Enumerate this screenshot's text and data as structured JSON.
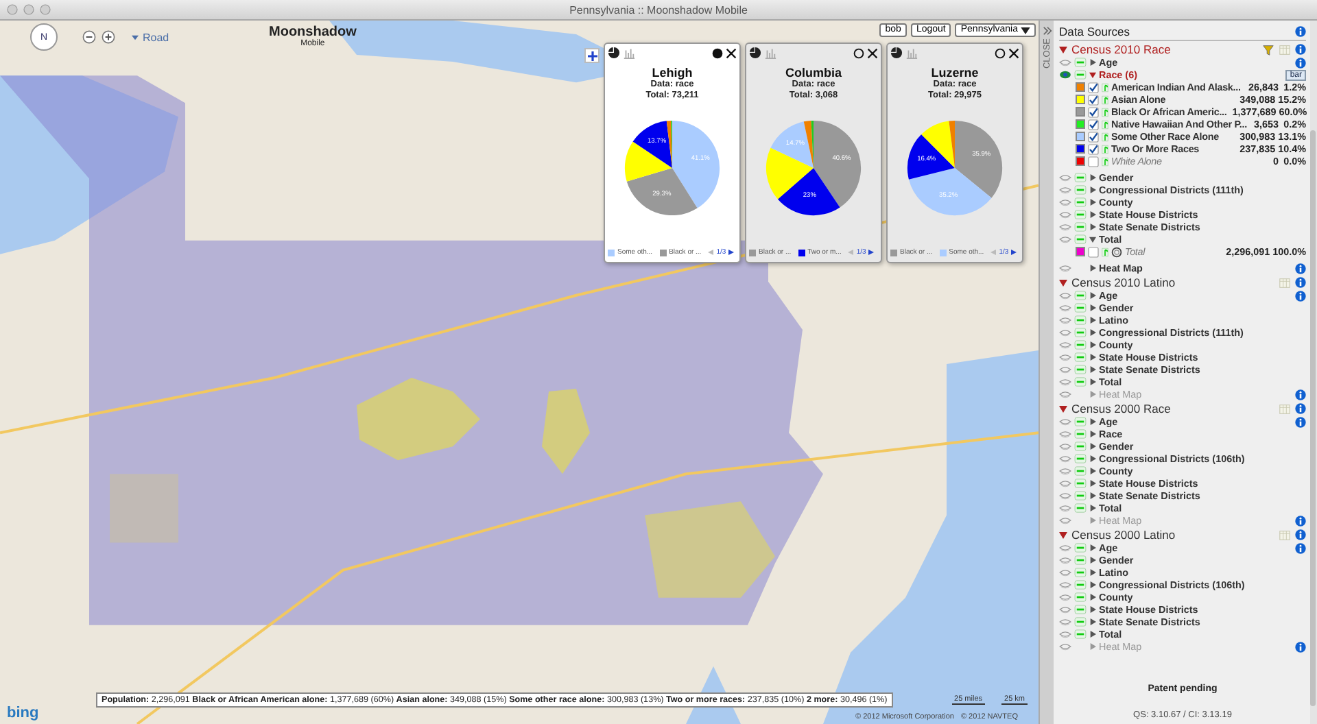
{
  "window": {
    "title": "Pennsylvania :: Moonshadow Mobile"
  },
  "map_controls": {
    "compass_label": "N",
    "map_type": "Road"
  },
  "logo": {
    "name": "Moonshadow",
    "sub": "Mobile"
  },
  "user_bar": {
    "user": "bob",
    "logout": "Logout",
    "region": "Pennsylvania"
  },
  "popups": [
    {
      "title": "Lehigh",
      "data": "Data: race",
      "total": "Total: 73,211",
      "selected": true,
      "chart_data": {
        "type": "pie",
        "colors": [
          "#aaccff",
          "#999999",
          "#ffff00",
          "#0000ee",
          "#f08000",
          "#22cc22"
        ],
        "values": [
          41.1,
          29.3,
          14.0,
          13.7,
          1.5,
          0.4
        ],
        "value_labels": [
          "41.1%",
          "29.3%",
          null,
          "13.7%",
          null,
          null
        ]
      },
      "legend": [
        {
          "label": "Some oth...",
          "color": "#aaccff"
        },
        {
          "label": "Black or ...",
          "color": "#999999"
        }
      ],
      "page": "1/3"
    },
    {
      "title": "Columbia",
      "data": "Data: race",
      "total": "Total: 3,068",
      "selected": false,
      "chart_data": {
        "type": "pie",
        "colors": [
          "#999999",
          "#0000ee",
          "#ffff00",
          "#aaccff",
          "#f08000",
          "#22cc22"
        ],
        "values": [
          40.6,
          23.0,
          18.4,
          14.7,
          2.5,
          0.8
        ],
        "value_labels": [
          "40.6%",
          "23%",
          null,
          "14.7%",
          null,
          null
        ]
      },
      "legend": [
        {
          "label": "Black or ...",
          "color": "#999999"
        },
        {
          "label": "Two or m...",
          "color": "#0000ee"
        }
      ],
      "page": "1/3"
    },
    {
      "title": "Luzerne",
      "data": "Data: race",
      "total": "Total: 29,975",
      "selected": false,
      "chart_data": {
        "type": "pie",
        "colors": [
          "#999999",
          "#aaccff",
          "#0000ee",
          "#ffff00",
          "#f08000"
        ],
        "values": [
          35.9,
          35.2,
          16.4,
          10.5,
          2.0
        ],
        "value_labels": [
          "35.9%",
          "35.2%",
          "16.4%",
          null,
          null
        ]
      },
      "legend": [
        {
          "label": "Black or ...",
          "color": "#999999"
        },
        {
          "label": "Some oth...",
          "color": "#aaccff"
        }
      ],
      "page": "1/3"
    }
  ],
  "close_tab": {
    "label": "CLOSE"
  },
  "status_bar": {
    "summary": "**Population:** 2,296,091  **Black or African American alone:** 1,377,689 (60%)  **Asian alone:** 349,088 (15%)  **Some other race alone:** 300,983 (13%)  **Two or more races:** 237,835 (10%)  **2 more:** 30,496 (1%)",
    "brand": "bing",
    "scale_miles": "25 miles",
    "scale_km": "25 km",
    "copyright": [
      "© 2012 Microsoft Corporation",
      "© 2012 NAVTEQ"
    ]
  },
  "sidebar": {
    "title": "Data Sources",
    "sections": [
      {
        "title": "Census 2010 Race",
        "selected": true,
        "filter": true,
        "items": [
          {
            "label": "Age",
            "kind": "layer",
            "visible": false,
            "expanded": false,
            "info": true,
            "disabled": false
          },
          {
            "label": "Race (6)",
            "kind": "layer",
            "visible": true,
            "expanded": true,
            "info": false,
            "disabled": false,
            "badge": "bar",
            "children": [
              {
                "label": "American Indian And Alask...",
                "value": "26,843",
                "pct": "1.2%",
                "color": "#f08000",
                "checked": true,
                "kind": "value"
              },
              {
                "label": "Asian Alone",
                "value": "349,088",
                "pct": "15.2%",
                "color": "#ffff00",
                "checked": true,
                "kind": "value"
              },
              {
                "label": "Black Or African Americ...",
                "value": "1,377,689",
                "pct": "60.0%",
                "color": "#999999",
                "checked": true,
                "kind": "value"
              },
              {
                "label": "Native Hawaiian And Other P...",
                "value": "3,653",
                "pct": "0.2%",
                "color": "#22ee22",
                "checked": true,
                "kind": "value"
              },
              {
                "label": "Some Other Race Alone",
                "value": "300,983",
                "pct": "13.1%",
                "color": "#aaccff",
                "checked": true,
                "kind": "value"
              },
              {
                "label": "Two Or More Races",
                "value": "237,835",
                "pct": "10.4%",
                "color": "#0000ee",
                "checked": true,
                "kind": "value"
              },
              {
                "label": "White Alone",
                "value": "0",
                "pct": "0.0%",
                "color": "#ee0000",
                "checked": false,
                "kind": "value"
              }
            ]
          },
          {
            "label": "Gender",
            "kind": "layer",
            "visible": false,
            "expanded": false,
            "info": false,
            "disabled": false
          },
          {
            "label": "Congressional Districts (111th)",
            "kind": "layer",
            "visible": false,
            "expanded": false,
            "info": false,
            "disabled": false
          },
          {
            "label": "County",
            "kind": "layer",
            "visible": false,
            "expanded": false,
            "info": false,
            "disabled": false
          },
          {
            "label": "State House Districts",
            "kind": "layer",
            "visible": false,
            "expanded": false,
            "info": false,
            "disabled": false
          },
          {
            "label": "State Senate Districts",
            "kind": "layer",
            "visible": false,
            "expanded": false,
            "info": false,
            "disabled": false
          },
          {
            "label": "Total",
            "kind": "layer",
            "visible": false,
            "expanded": true,
            "info": false,
            "disabled": false,
            "children": [
              {
                "label": "Total",
                "value": "2,296,091",
                "pct": "100.0%",
                "color": "#ee00cc",
                "checked": false,
                "kind": "total"
              }
            ]
          },
          {
            "label": "Heat Map",
            "kind": "heatmap",
            "visible": false,
            "expanded": false,
            "info": true,
            "disabled": false
          }
        ]
      },
      {
        "title": "Census 2010 Latino",
        "selected": false,
        "filter": false,
        "items": [
          {
            "label": "Age",
            "kind": "layer",
            "visible": false,
            "expanded": false,
            "info": true,
            "disabled": false
          },
          {
            "label": "Gender",
            "kind": "layer",
            "visible": false,
            "expanded": false,
            "info": false,
            "disabled": false
          },
          {
            "label": "Latino",
            "kind": "layer",
            "visible": false,
            "expanded": false,
            "info": false,
            "disabled": false
          },
          {
            "label": "Congressional Districts (111th)",
            "kind": "layer",
            "visible": false,
            "expanded": false,
            "info": false,
            "disabled": false
          },
          {
            "label": "County",
            "kind": "layer",
            "visible": false,
            "expanded": false,
            "info": false,
            "disabled": false
          },
          {
            "label": "State House Districts",
            "kind": "layer",
            "visible": false,
            "expanded": false,
            "info": false,
            "disabled": false
          },
          {
            "label": "State Senate Districts",
            "kind": "layer",
            "visible": false,
            "expanded": false,
            "info": false,
            "disabled": false
          },
          {
            "label": "Total",
            "kind": "layer",
            "visible": false,
            "expanded": false,
            "info": false,
            "disabled": false
          },
          {
            "label": "Heat Map",
            "kind": "heatmap",
            "visible": false,
            "expanded": false,
            "info": true,
            "disabled": true
          }
        ]
      },
      {
        "title": "Census 2000 Race",
        "selected": false,
        "filter": false,
        "items": [
          {
            "label": "Age",
            "kind": "layer",
            "visible": false,
            "expanded": false,
            "info": true,
            "disabled": false
          },
          {
            "label": "Race",
            "kind": "layer",
            "visible": false,
            "expanded": false,
            "info": false,
            "disabled": false
          },
          {
            "label": "Gender",
            "kind": "layer",
            "visible": false,
            "expanded": false,
            "info": false,
            "disabled": false
          },
          {
            "label": "Congressional Districts (106th)",
            "kind": "layer",
            "visible": false,
            "expanded": false,
            "info": false,
            "disabled": false
          },
          {
            "label": "County",
            "kind": "layer",
            "visible": false,
            "expanded": false,
            "info": false,
            "disabled": false
          },
          {
            "label": "State House Districts",
            "kind": "layer",
            "visible": false,
            "expanded": false,
            "info": false,
            "disabled": false
          },
          {
            "label": "State Senate Districts",
            "kind": "layer",
            "visible": false,
            "expanded": false,
            "info": false,
            "disabled": false
          },
          {
            "label": "Total",
            "kind": "layer",
            "visible": false,
            "expanded": false,
            "info": false,
            "disabled": false
          },
          {
            "label": "Heat Map",
            "kind": "heatmap",
            "visible": false,
            "expanded": false,
            "info": true,
            "disabled": true
          }
        ]
      },
      {
        "title": "Census 2000 Latino",
        "selected": false,
        "filter": false,
        "items": [
          {
            "label": "Age",
            "kind": "layer",
            "visible": false,
            "expanded": false,
            "info": true,
            "disabled": false
          },
          {
            "label": "Gender",
            "kind": "layer",
            "visible": false,
            "expanded": false,
            "info": false,
            "disabled": false
          },
          {
            "label": "Latino",
            "kind": "layer",
            "visible": false,
            "expanded": false,
            "info": false,
            "disabled": false
          },
          {
            "label": "Congressional Districts (106th)",
            "kind": "layer",
            "visible": false,
            "expanded": false,
            "info": false,
            "disabled": false
          },
          {
            "label": "County",
            "kind": "layer",
            "visible": false,
            "expanded": false,
            "info": false,
            "disabled": false
          },
          {
            "label": "State House Districts",
            "kind": "layer",
            "visible": false,
            "expanded": false,
            "info": false,
            "disabled": false
          },
          {
            "label": "State Senate Districts",
            "kind": "layer",
            "visible": false,
            "expanded": false,
            "info": false,
            "disabled": false
          },
          {
            "label": "Total",
            "kind": "layer",
            "visible": false,
            "expanded": false,
            "info": false,
            "disabled": false
          },
          {
            "label": "Heat Map",
            "kind": "heatmap",
            "visible": false,
            "expanded": false,
            "info": true,
            "disabled": true
          }
        ]
      }
    ],
    "patent": "Patent pending",
    "version": "QS: 3.10.67 / CI: 3.13.19"
  }
}
